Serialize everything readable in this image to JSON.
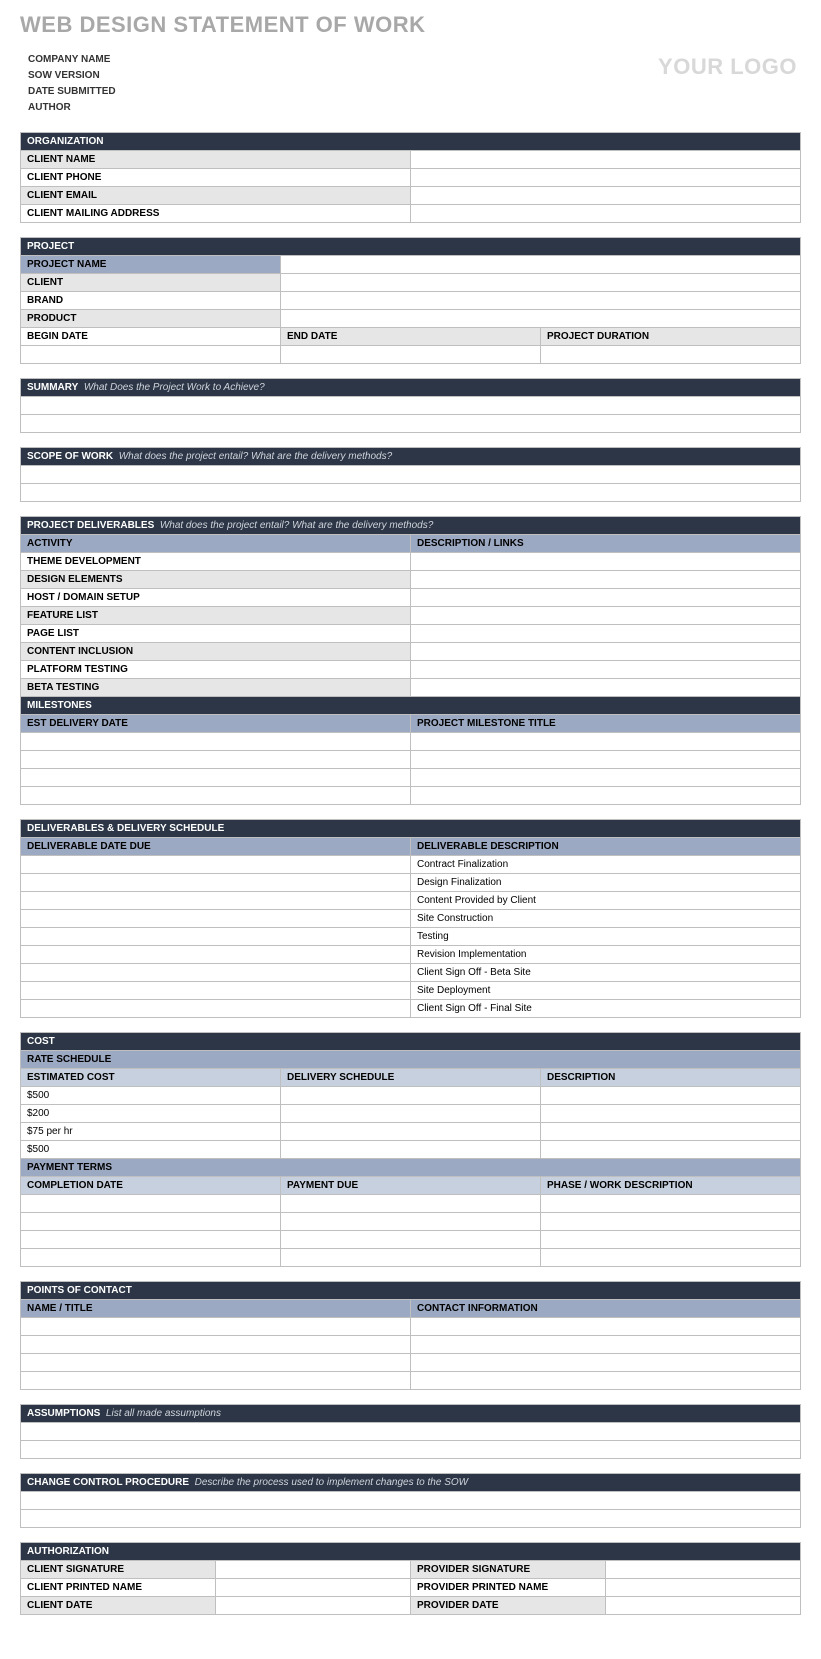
{
  "title": "WEB DESIGN STATEMENT OF WORK",
  "logo": "YOUR LOGO",
  "meta": {
    "company": "COMPANY NAME",
    "version": "SOW VERSION",
    "date": "DATE SUBMITTED",
    "author": "AUTHOR"
  },
  "org": {
    "header": "ORGANIZATION",
    "rows": [
      "CLIENT NAME",
      "CLIENT  PHONE",
      "CLIENT EMAIL",
      "CLIENT MAILING ADDRESS"
    ]
  },
  "project": {
    "header": "PROJECT",
    "rows": [
      "PROJECT NAME",
      "CLIENT",
      "BRAND",
      "PRODUCT"
    ],
    "begin": "BEGIN DATE",
    "end": "END DATE",
    "duration": "PROJECT DURATION"
  },
  "summary": {
    "label": "SUMMARY",
    "hint": "What Does the Project Work to Achieve?"
  },
  "scope": {
    "label": "SCOPE OF WORK",
    "hint": "What does the project entail? What are the delivery methods?"
  },
  "deliverables": {
    "label": "PROJECT DELIVERABLES",
    "hint": "What does the project entail? What are the delivery methods?",
    "col1": "ACTIVITY",
    "col2": "DESCRIPTION / LINKS",
    "rows": [
      "THEME DEVELOPMENT",
      "DESIGN ELEMENTS",
      "HOST / DOMAIN SETUP",
      "FEATURE LIST",
      "PAGE LIST",
      "CONTENT INCLUSION",
      "PLATFORM TESTING",
      "BETA TESTING"
    ]
  },
  "milestones": {
    "header": "MILESTONES",
    "col1": "EST DELIVERY DATE",
    "col2": "PROJECT MILESTONE TITLE"
  },
  "schedule": {
    "header": "DELIVERABLES & DELIVERY SCHEDULE",
    "col1": "DELIVERABLE DATE DUE",
    "col2": "DELIVERABLE DESCRIPTION",
    "rows": [
      "Contract Finalization",
      "Design Finalization",
      "Content Provided by Client",
      "Site Construction",
      "Testing",
      "Revision Implementation",
      "Client Sign Off - Beta Site",
      "Site Deployment",
      "Client Sign Off - Final Site"
    ]
  },
  "cost": {
    "header": "COST",
    "rate": "RATE SCHEDULE",
    "col1": "ESTIMATED COST",
    "col2": "DELIVERY SCHEDULE",
    "col3": "DESCRIPTION",
    "rows": [
      "$500",
      "$200",
      "$75 per hr",
      "$500"
    ],
    "terms": "PAYMENT TERMS",
    "pcol1": "COMPLETION DATE",
    "pcol2": "PAYMENT DUE",
    "pcol3": "PHASE / WORK DESCRIPTION"
  },
  "contact": {
    "header": "POINTS OF CONTACT",
    "col1": "NAME / TITLE",
    "col2": "CONTACT INFORMATION"
  },
  "assumptions": {
    "label": "ASSUMPTIONS",
    "hint": "List all made assumptions"
  },
  "change": {
    "label": "CHANGE CONTROL PROCEDURE",
    "hint": "Describe the process used to implement changes to the SOW"
  },
  "auth": {
    "header": "AUTHORIZATION",
    "csig": "CLIENT SIGNATURE",
    "psig": "PROVIDER SIGNATURE",
    "cname": "CLIENT PRINTED NAME",
    "pname": "PROVIDER PRINTED NAME",
    "cdate": "CLIENT DATE",
    "pdate": "PROVIDER DATE"
  }
}
